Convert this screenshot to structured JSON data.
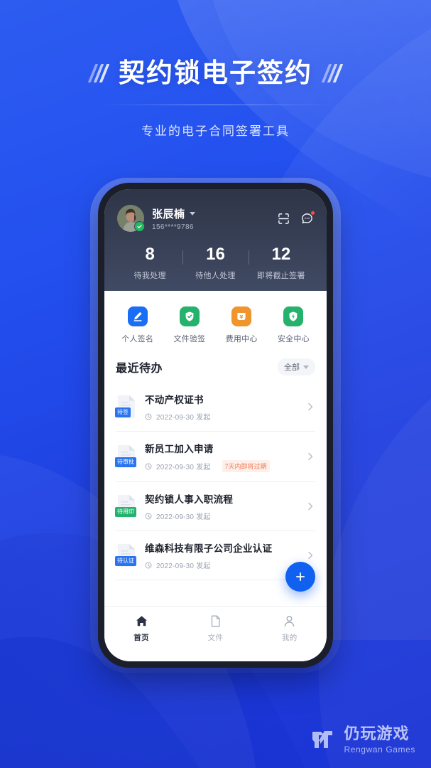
{
  "hero": {
    "title": "契约锁电子签约",
    "subtitle": "专业的电子合同签署工具"
  },
  "app": {
    "header": {
      "user_name": "张辰楠",
      "user_phone": "156****9786",
      "avatar_label": "user-avatar-photo",
      "verified_icon": "check-badge-icon",
      "scan_icon": "scan-icon",
      "chat_icon": "chat-bubble-icon",
      "chat_has_unread": true,
      "stats": [
        {
          "value": "8",
          "label": "待我处理"
        },
        {
          "value": "16",
          "label": "待他人处理"
        },
        {
          "value": "12",
          "label": "即将截止签署"
        }
      ]
    },
    "quick_actions": [
      {
        "label": "个人签名",
        "icon": "pen-sign-icon",
        "color": "#1a6ef5"
      },
      {
        "label": "文件验签",
        "icon": "shield-check-icon",
        "color": "#24b26d"
      },
      {
        "label": "费用中心",
        "icon": "yuan-wallet-icon",
        "color": "#f0942e"
      },
      {
        "label": "安全中心",
        "icon": "shield-bolt-icon",
        "color": "#24b26d"
      }
    ],
    "section": {
      "title": "最近待办",
      "filter_label": "全部",
      "filter_caret_icon": "chevron-down-icon"
    },
    "todos": [
      {
        "title": "不动产权证书",
        "badge": "待签",
        "badge_color": "#2b74ef",
        "date": "2022-09-30 发起",
        "warning": ""
      },
      {
        "title": "新员工加入申请",
        "badge": "待审批",
        "badge_color": "#2b74ef",
        "date": "2022-09-30 发起",
        "warning": "7天内即将过期"
      },
      {
        "title": "契约锁人事入职流程",
        "badge": "待用印",
        "badge_color": "#24b26d",
        "date": "2022-09-30 发起",
        "warning": ""
      },
      {
        "title": "维森科技有限子公司企业认证",
        "badge": "待认证",
        "badge_color": "#2b74ef",
        "date": "2022-09-30 发起",
        "warning": ""
      }
    ],
    "fab": {
      "icon": "plus-icon",
      "color": "#1061f0"
    },
    "tabbar": [
      {
        "label": "首页",
        "icon": "home-icon",
        "active": true
      },
      {
        "label": "文件",
        "icon": "file-icon",
        "active": false
      },
      {
        "label": "我的",
        "icon": "person-icon",
        "active": false
      }
    ]
  },
  "watermark": {
    "logo_icon": "rengwan-logo-icon",
    "cn": "仍玩游戏",
    "en": "Rengwan Games"
  }
}
